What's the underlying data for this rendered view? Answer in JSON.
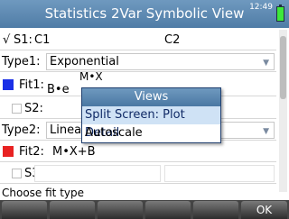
{
  "header": {
    "title": "Statistics 2Var Symbolic View",
    "clock": "12:49"
  },
  "s1": {
    "label": "S1:",
    "checked_mark": "√",
    "col1": "C1",
    "col2": "C2"
  },
  "type1": {
    "label": "Type1:",
    "value": "Exponential"
  },
  "fit1": {
    "label": "Fit1:",
    "value": "B•e",
    "superscript": "M•X"
  },
  "s2": {
    "label": "S2:"
  },
  "type2": {
    "label": "Type2:",
    "value": "Linea"
  },
  "fit2": {
    "label": "Fit2:",
    "value": "M•X+B"
  },
  "s3": {
    "label": "S3:"
  },
  "popup": {
    "title": "Views",
    "items": [
      {
        "label": "Split Screen: Plot Detail"
      },
      {
        "label": "Autoscale"
      }
    ]
  },
  "status": "Choose fit type",
  "softkeys": [
    "",
    "",
    "",
    "",
    "",
    "OK"
  ],
  "colors": {
    "fit1": "#1a2fe6",
    "fit2": "#e82222",
    "accent": "#5583ad"
  }
}
